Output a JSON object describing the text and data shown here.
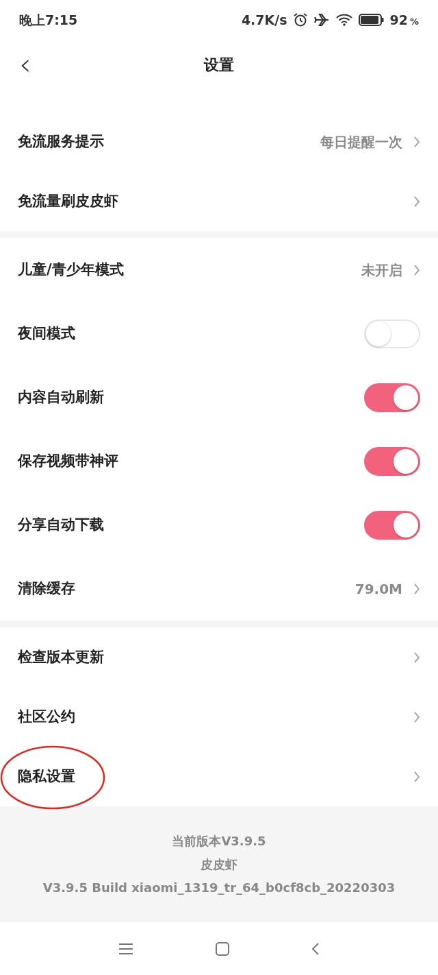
{
  "status_bar": {
    "time": "晚上7:15",
    "speed": "4.7K/s",
    "battery": "92",
    "battery_unit": "%"
  },
  "header": {
    "back": "‹",
    "title": "设置"
  },
  "groups": [
    {
      "items": [
        {
          "kind": "value",
          "label": "免流服务提示",
          "value": "每日提醒一次"
        },
        {
          "kind": "link",
          "label": "免流量刷皮皮虾"
        }
      ]
    },
    {
      "items": [
        {
          "kind": "value",
          "label": "儿童/青少年模式",
          "value": "未开启"
        },
        {
          "kind": "toggle",
          "label": "夜间模式",
          "on": false
        },
        {
          "kind": "toggle",
          "label": "内容自动刷新",
          "on": true
        },
        {
          "kind": "toggle",
          "label": "保存视频带神评",
          "on": true
        },
        {
          "kind": "toggle",
          "label": "分享自动下载",
          "on": true
        },
        {
          "kind": "value",
          "label": "清除缓存",
          "value": "79.0M"
        }
      ]
    },
    {
      "items": [
        {
          "kind": "link",
          "label": "检查版本更新"
        },
        {
          "kind": "link",
          "label": "社区公约"
        },
        {
          "kind": "link",
          "label": "隐私设置",
          "highlighted": true
        }
      ]
    }
  ],
  "footer": [
    "当前版本V3.9.5",
    "皮皮虾",
    "V3.9.5 Build xiaomi_1319_tr_64_b0cf8cb_20220303"
  ]
}
